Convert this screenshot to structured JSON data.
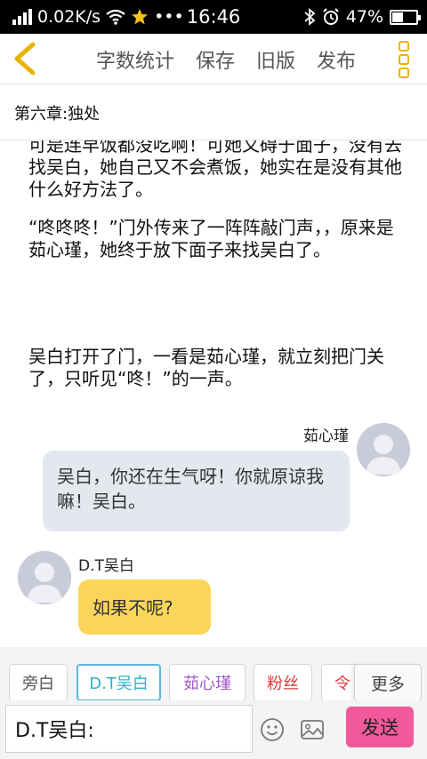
{
  "status_bar": {
    "speed": "0.02K/s",
    "time": "16:46",
    "more_dots": "•••",
    "battery": "47%",
    "battery_level": 0.47
  },
  "toolbar": {
    "actions": [
      "字数统计",
      "保存",
      "旧版",
      "发布"
    ],
    "accent": "#e8b400"
  },
  "chapter": {
    "title": "第六章:独处"
  },
  "content": {
    "paragraphs": [
      "可是连早饭都没吃啊！可她又碍于面子，没有去找吴白，她自己又不会煮饭，她实在是没有其他什么好方法了。",
      "“咚咚咚！”门外传来了一阵阵敲门声，，原来是茹心瑾，她终于放下面子来找吴白了。",
      "吴白打开了门，一看是茹心瑾，就立刻把门关了，只听见“咚！”的一声。"
    ],
    "messages": [
      {
        "name": "茹心瑾",
        "text": "吴白，你还在生气呀！你就原谅我嘛！吴白。",
        "side": "right",
        "bubble_color": "#e3e7ee"
      },
      {
        "name": "D.T吴白",
        "text": "如果不呢?",
        "side": "left",
        "bubble_color": "#fbd55a"
      }
    ]
  },
  "roles": [
    {
      "label": "旁白",
      "color": "#555555"
    },
    {
      "label": "D.T吴白",
      "color": "#2fb2c8",
      "selected": true
    },
    {
      "label": "茹心瑾",
      "color": "#a257c8"
    },
    {
      "label": "粉丝",
      "color": "#e23a3a"
    },
    {
      "label": "令",
      "color": "#e23a3a"
    }
  ],
  "more_label": "更多",
  "input": {
    "value": "D.T吴白:"
  },
  "send_label": "发送",
  "send_color": "#f05a9a"
}
